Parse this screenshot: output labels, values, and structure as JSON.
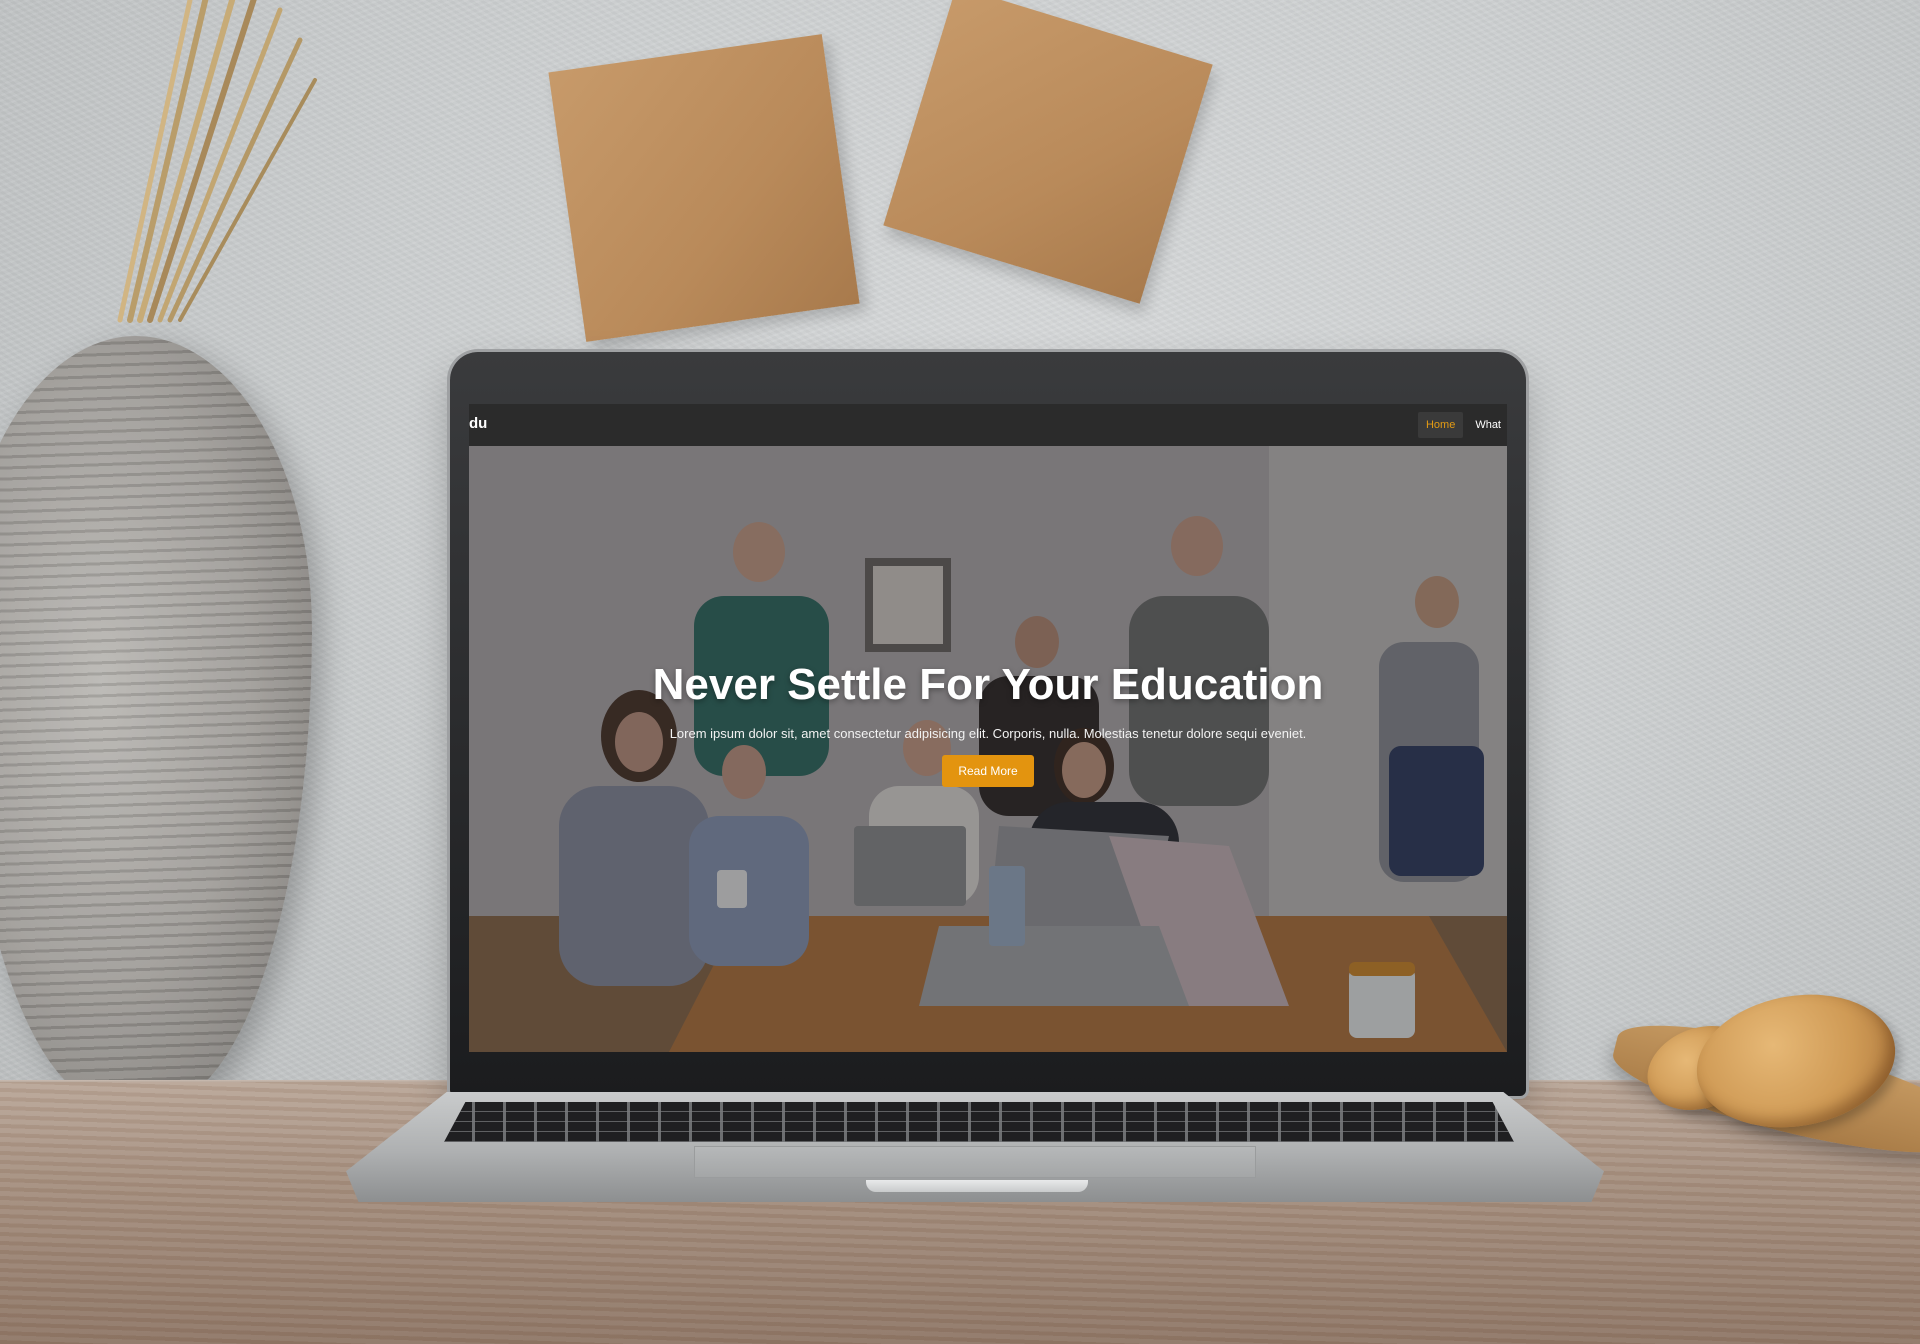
{
  "site": {
    "brand": "du",
    "nav": [
      {
        "label": "Home",
        "active": true
      },
      {
        "label": "What",
        "active": false
      }
    ],
    "hero": {
      "title": "Never Settle For Your Education",
      "subtitle": "Lorem ipsum dolor sit, amet consectetur adipisicing elit. Corporis, nulla. Molestias tenetur dolore sequi eveniet.",
      "button_label": "Read More"
    }
  },
  "colors": {
    "accent": "#e3940f",
    "nav_background": "#2b2b2b",
    "hero_overlay": "rgba(25,25,30,0.38)"
  },
  "icons": []
}
